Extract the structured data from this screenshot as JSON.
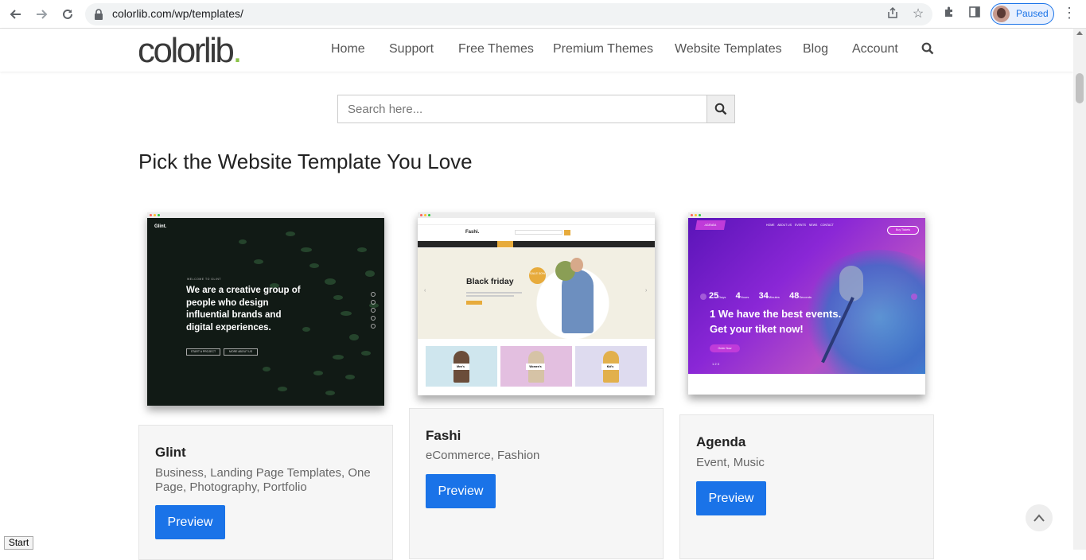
{
  "browser": {
    "url": "colorlib.com/wp/templates/",
    "profile_status": "Paused"
  },
  "site": {
    "logo_text": "colorlib",
    "logo_dot": ".",
    "logo_dot_color": "#8bc34a",
    "menu": [
      "Home",
      "Support",
      "Free Themes",
      "Premium Themes",
      "Website Templates",
      "Blog",
      "Account"
    ]
  },
  "search": {
    "placeholder": "Search here...",
    "value": ""
  },
  "heading": "Pick the Website Template You Love",
  "templates": [
    {
      "name": "Glint",
      "tags": "Business, Landing Page Templates, One Page, Photography, Portfolio",
      "button": "Preview",
      "screenshot": {
        "brand": "Glint.",
        "eyebrow": "WELCOME TO GLINT",
        "headline": "We are a creative group of people who design influential brands and digital experiences.",
        "cta1": "START A PROJECT",
        "cta2": "MORE ABOUT US"
      }
    },
    {
      "name": "Fashi",
      "tags": "eCommerce, Fashion",
      "button": "Preview",
      "screenshot": {
        "brand": "Fashi.",
        "headline": "Black friday",
        "badge": "SALE 50%",
        "categories": [
          "Men's",
          "Women's",
          "Kid's"
        ]
      }
    },
    {
      "name": "Agenda",
      "tags": "Event, Music",
      "button": "Preview",
      "screenshot": {
        "brand": "AGENDA",
        "nav": [
          "HOME",
          "ABOUT US",
          "EVENTS",
          "NEWS",
          "CONTACT"
        ],
        "cta": "Buy Tickets",
        "countdown": [
          {
            "value": "25",
            "unit": "Days"
          },
          {
            "value": "4",
            "unit": "Hours"
          },
          {
            "value": "34",
            "unit": "Minutes"
          },
          {
            "value": "48",
            "unit": "Seconds"
          }
        ],
        "headline_1": "1 We have the best events.",
        "headline_2": "Get your tiket now!",
        "button": "Order Now",
        "pager": "1 2 3"
      }
    }
  ],
  "status_tooltip": "Start",
  "colors": {
    "accent": "#1a73e8",
    "card_bg": "#f6f6f6",
    "agenda_purple": "#6a1fd0"
  }
}
